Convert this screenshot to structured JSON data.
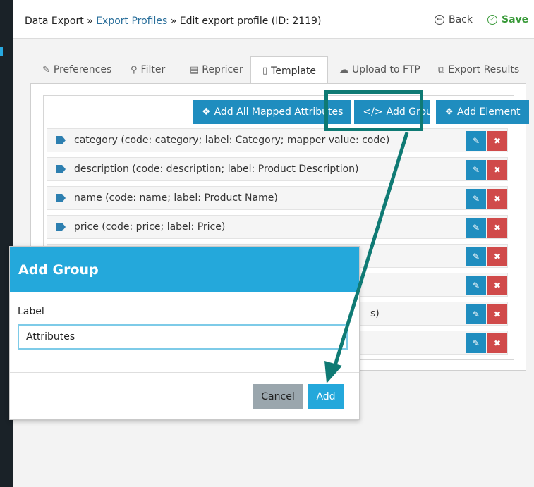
{
  "header": {
    "breadcrumb": {
      "part1": "Data Export",
      "sep": " » ",
      "part2": "Export Profiles",
      "part3": "Edit export profile (ID: 2119)"
    },
    "back_label": "Back",
    "save_label": "Save"
  },
  "tabs": [
    {
      "label": "Preferences",
      "icon": "edit-icon"
    },
    {
      "label": "Filter",
      "icon": "search-icon"
    },
    {
      "label": "Repricer",
      "icon": "list-icon"
    },
    {
      "label": "Template",
      "icon": "file-icon",
      "active": true
    },
    {
      "label": "Upload to FTP",
      "icon": "cloud-upload-icon"
    },
    {
      "label": "Export Results",
      "icon": "copy-icon"
    }
  ],
  "toolbar": {
    "add_all_label": "Add All Mapped Attributes",
    "add_group_label": "Add Group",
    "add_element_label": "Add Element"
  },
  "rows": [
    {
      "text": "category (code: category; label: Category; mapper value: code)"
    },
    {
      "text": "description (code: description; label: Product Description)"
    },
    {
      "text": "name (code: name; label: Product Name)"
    },
    {
      "text": "price (code: price; label: Price)"
    },
    {
      "text": ""
    },
    {
      "text": ""
    },
    {
      "text": "s)"
    },
    {
      "text": ""
    }
  ],
  "modal": {
    "title": "Add Group",
    "field_label": "Label",
    "input_value": "Attributes",
    "cancel_label": "Cancel",
    "add_label": "Add"
  },
  "colors": {
    "accent": "#24a8db",
    "button_blue": "#1f8dbf",
    "delete_red": "#d04a4a",
    "highlight_teal": "#0f7a74",
    "save_green": "#3a9a3a"
  }
}
